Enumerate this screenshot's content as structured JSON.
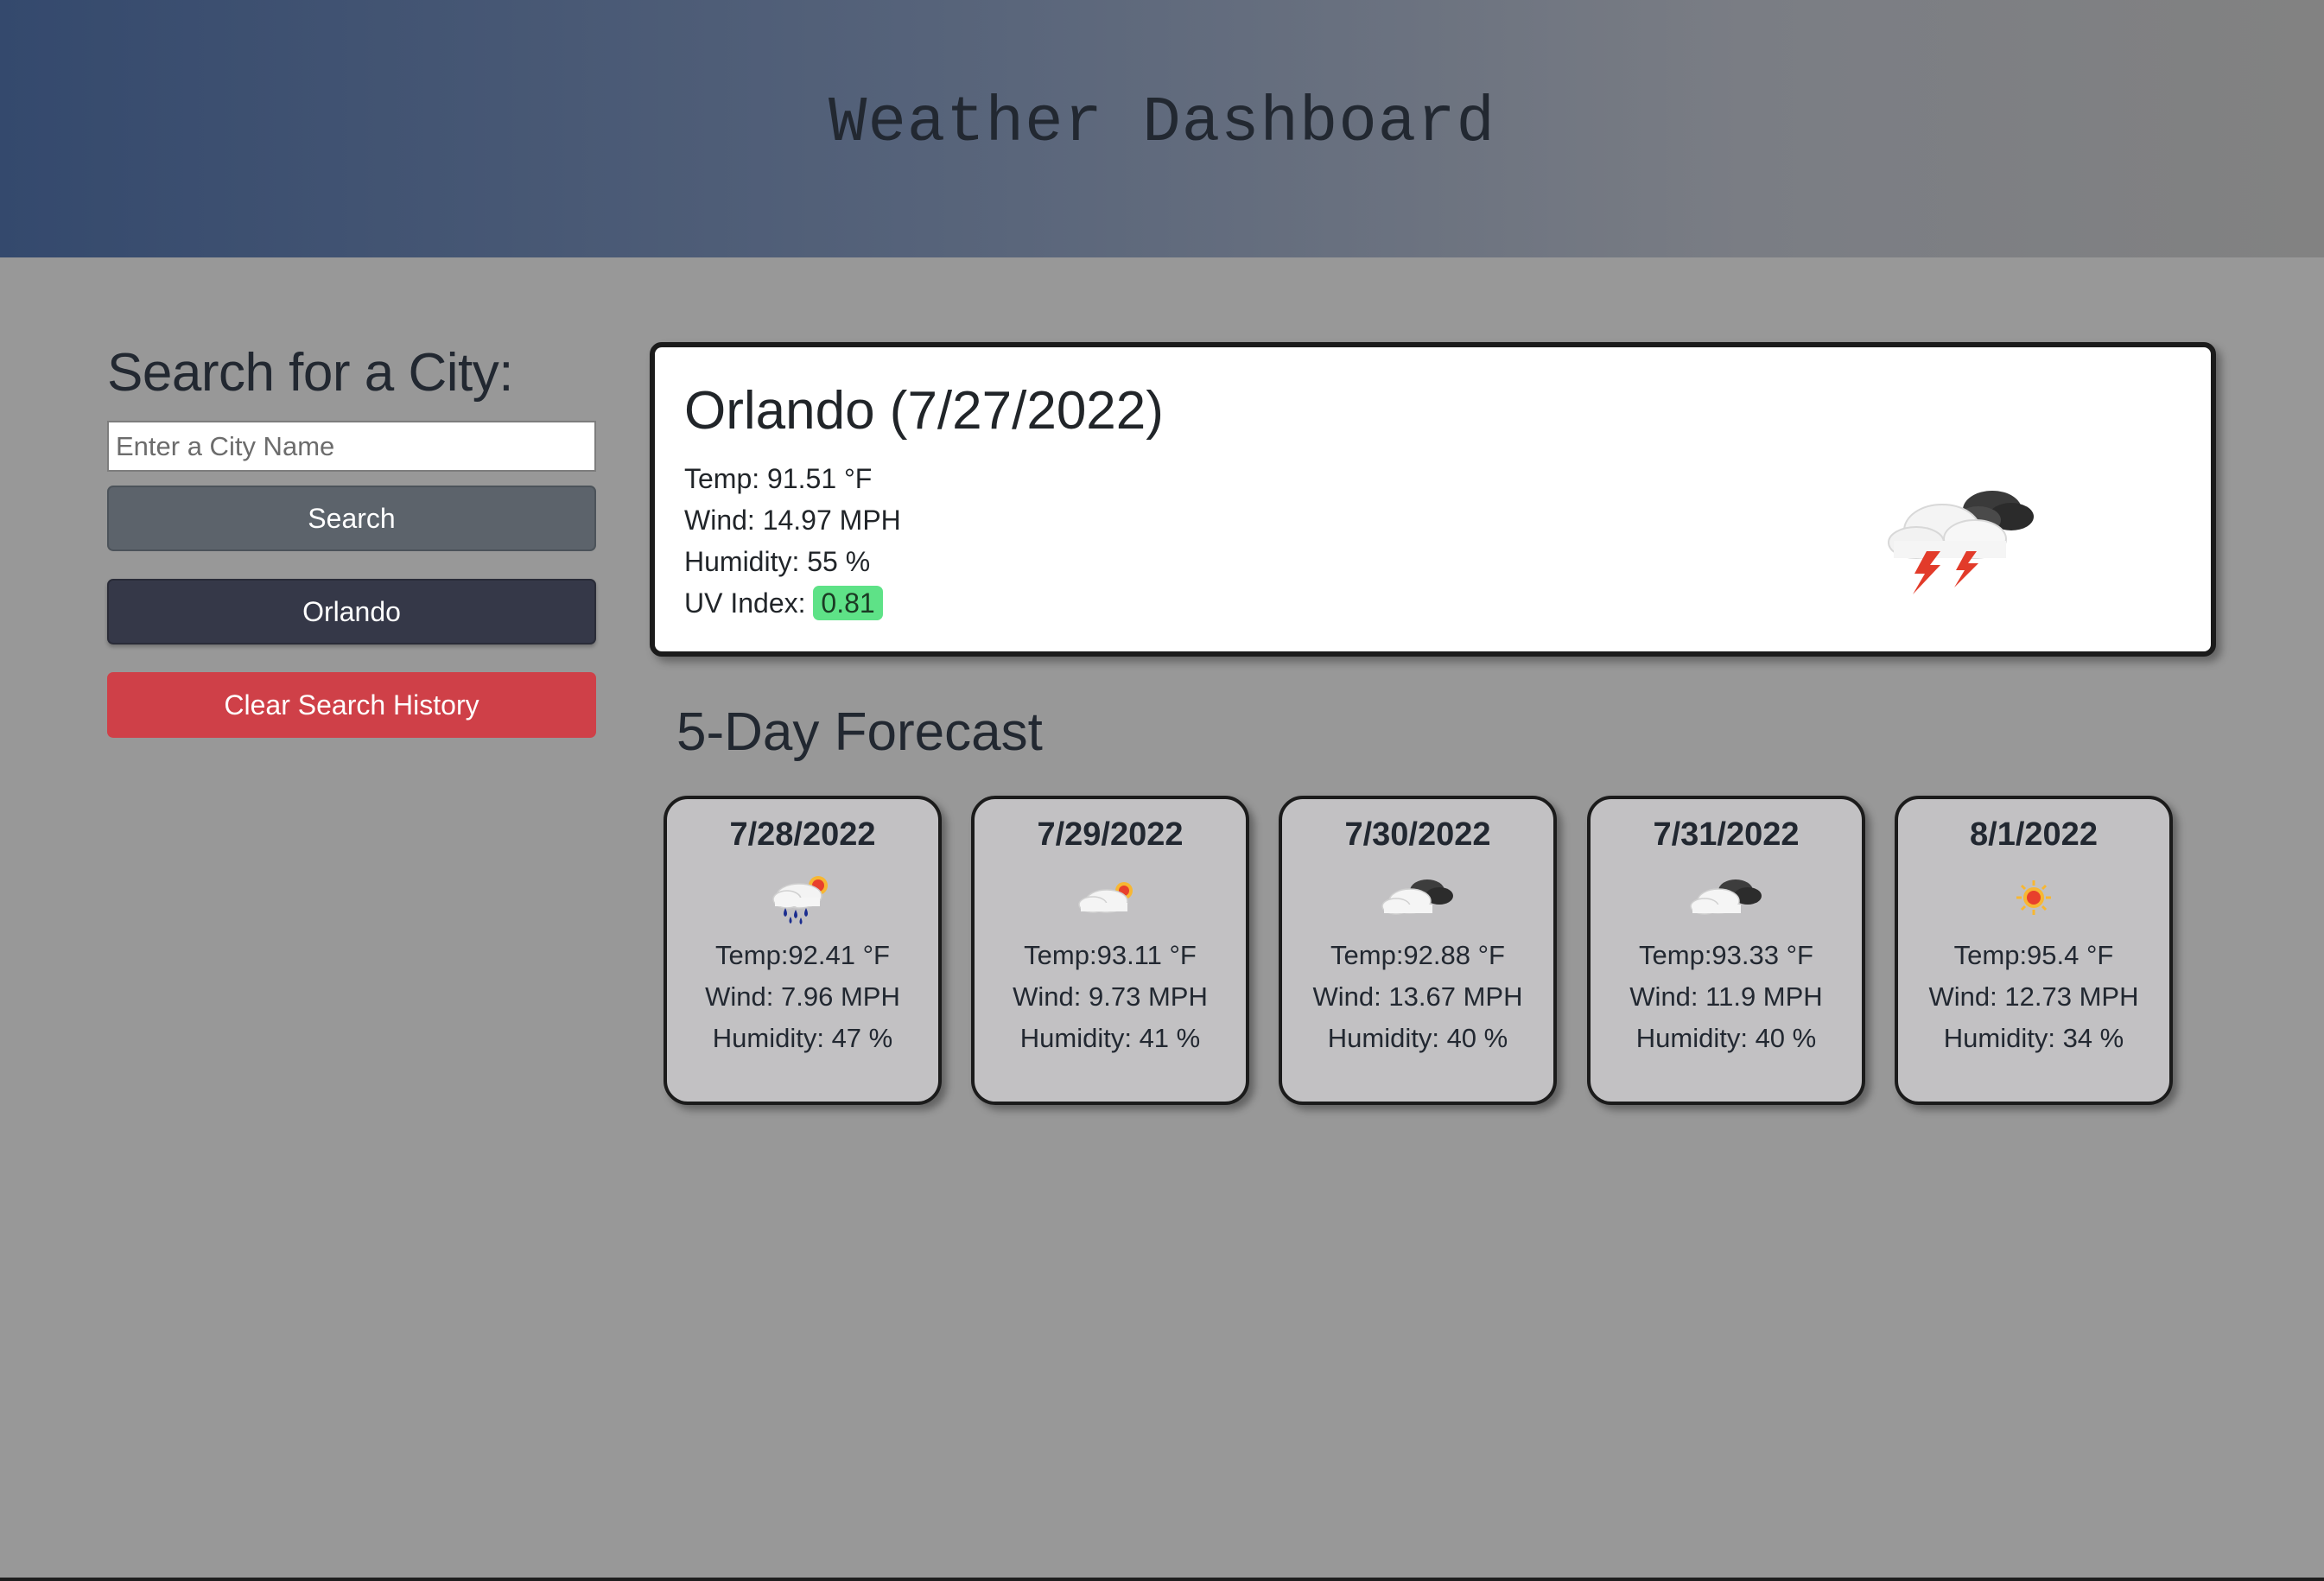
{
  "header": {
    "title": "Weather Dashboard"
  },
  "sidebar": {
    "heading": "Search for a City:",
    "input_placeholder": "Enter a City Name",
    "input_value": "",
    "search_label": "Search",
    "history": [
      "Orlando"
    ],
    "clear_label": "Clear Search History"
  },
  "current": {
    "title": "Orlando (7/27/2022)",
    "temp": "Temp: 91.51 °F",
    "wind": "Wind: 14.97 MPH",
    "humidity": "Humidity: 55 %",
    "uv_label": "UV Index:",
    "uv_value": "0.81",
    "icon": "thunderstorm-icon"
  },
  "forecast": {
    "title": "5-Day Forecast",
    "days": [
      {
        "date": "7/28/2022",
        "icon": "rain-sun-icon",
        "temp": "Temp:92.41 °F",
        "wind": "Wind: 7.96 MPH",
        "humidity": "Humidity: 47 %"
      },
      {
        "date": "7/29/2022",
        "icon": "cloud-sun-icon",
        "temp": "Temp:93.11 °F",
        "wind": "Wind: 9.73 MPH",
        "humidity": "Humidity: 41 %"
      },
      {
        "date": "7/30/2022",
        "icon": "cloudy-icon",
        "temp": "Temp:92.88 °F",
        "wind": "Wind: 13.67 MPH",
        "humidity": "Humidity: 40 %"
      },
      {
        "date": "7/31/2022",
        "icon": "cloudy-icon",
        "temp": "Temp:93.33 °F",
        "wind": "Wind: 11.9 MPH",
        "humidity": "Humidity: 40 %"
      },
      {
        "date": "8/1/2022",
        "icon": "sun-icon",
        "temp": "Temp:95.4 °F",
        "wind": "Wind: 12.73 MPH",
        "humidity": "Humidity: 34 %"
      }
    ]
  },
  "colors": {
    "search_button": "#5c636b",
    "history_button": "#353848",
    "clear_button": "#cf4048",
    "uv_badge": "#5ee287",
    "card_bg": "#c2c1c3",
    "page_bg": "#989898"
  }
}
